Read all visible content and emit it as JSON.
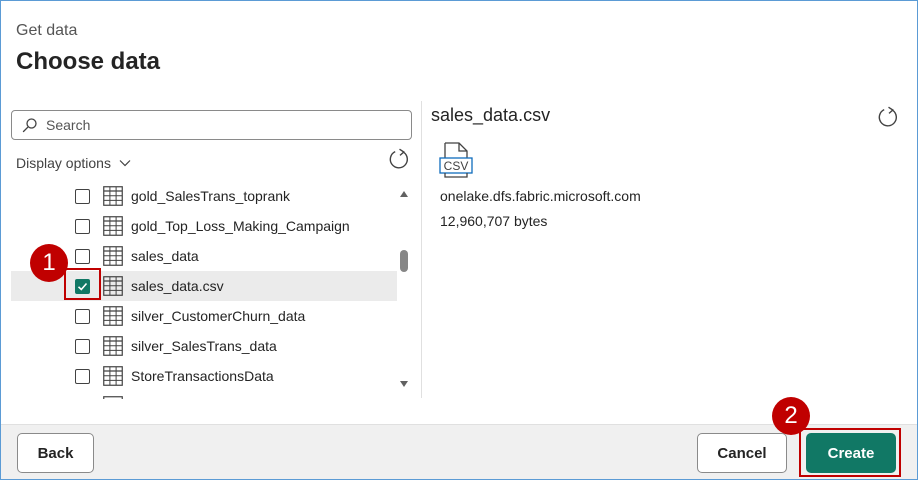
{
  "header": {
    "subtitle": "Get data",
    "title": "Choose data"
  },
  "search": {
    "placeholder": "Search",
    "value": ""
  },
  "display_options": {
    "label": "Display options"
  },
  "items": [
    {
      "label": "gold_SalesTrans_toprank",
      "checked": false
    },
    {
      "label": "gold_Top_Loss_Making_Campaign",
      "checked": false
    },
    {
      "label": "sales_data",
      "checked": false
    },
    {
      "label": "sales_data.csv",
      "checked": true,
      "selected": true
    },
    {
      "label": "silver_CustomerChurn_data",
      "checked": false
    },
    {
      "label": "silver_SalesTrans_data",
      "checked": false
    },
    {
      "label": "StoreTransactionsData",
      "checked": false
    }
  ],
  "preview": {
    "file_name": "sales_data.csv",
    "file_type_badge": "CSV",
    "source": "onelake.dfs.fabric.microsoft.com",
    "size": "12,960,707 bytes"
  },
  "footer": {
    "back_label": "Back",
    "cancel_label": "Cancel",
    "create_label": "Create"
  },
  "annotations": {
    "step_1": "1",
    "step_2": "2"
  },
  "colors": {
    "accent": "#117865",
    "highlight": "#c00000",
    "frame_border": "#5b9bd5"
  }
}
